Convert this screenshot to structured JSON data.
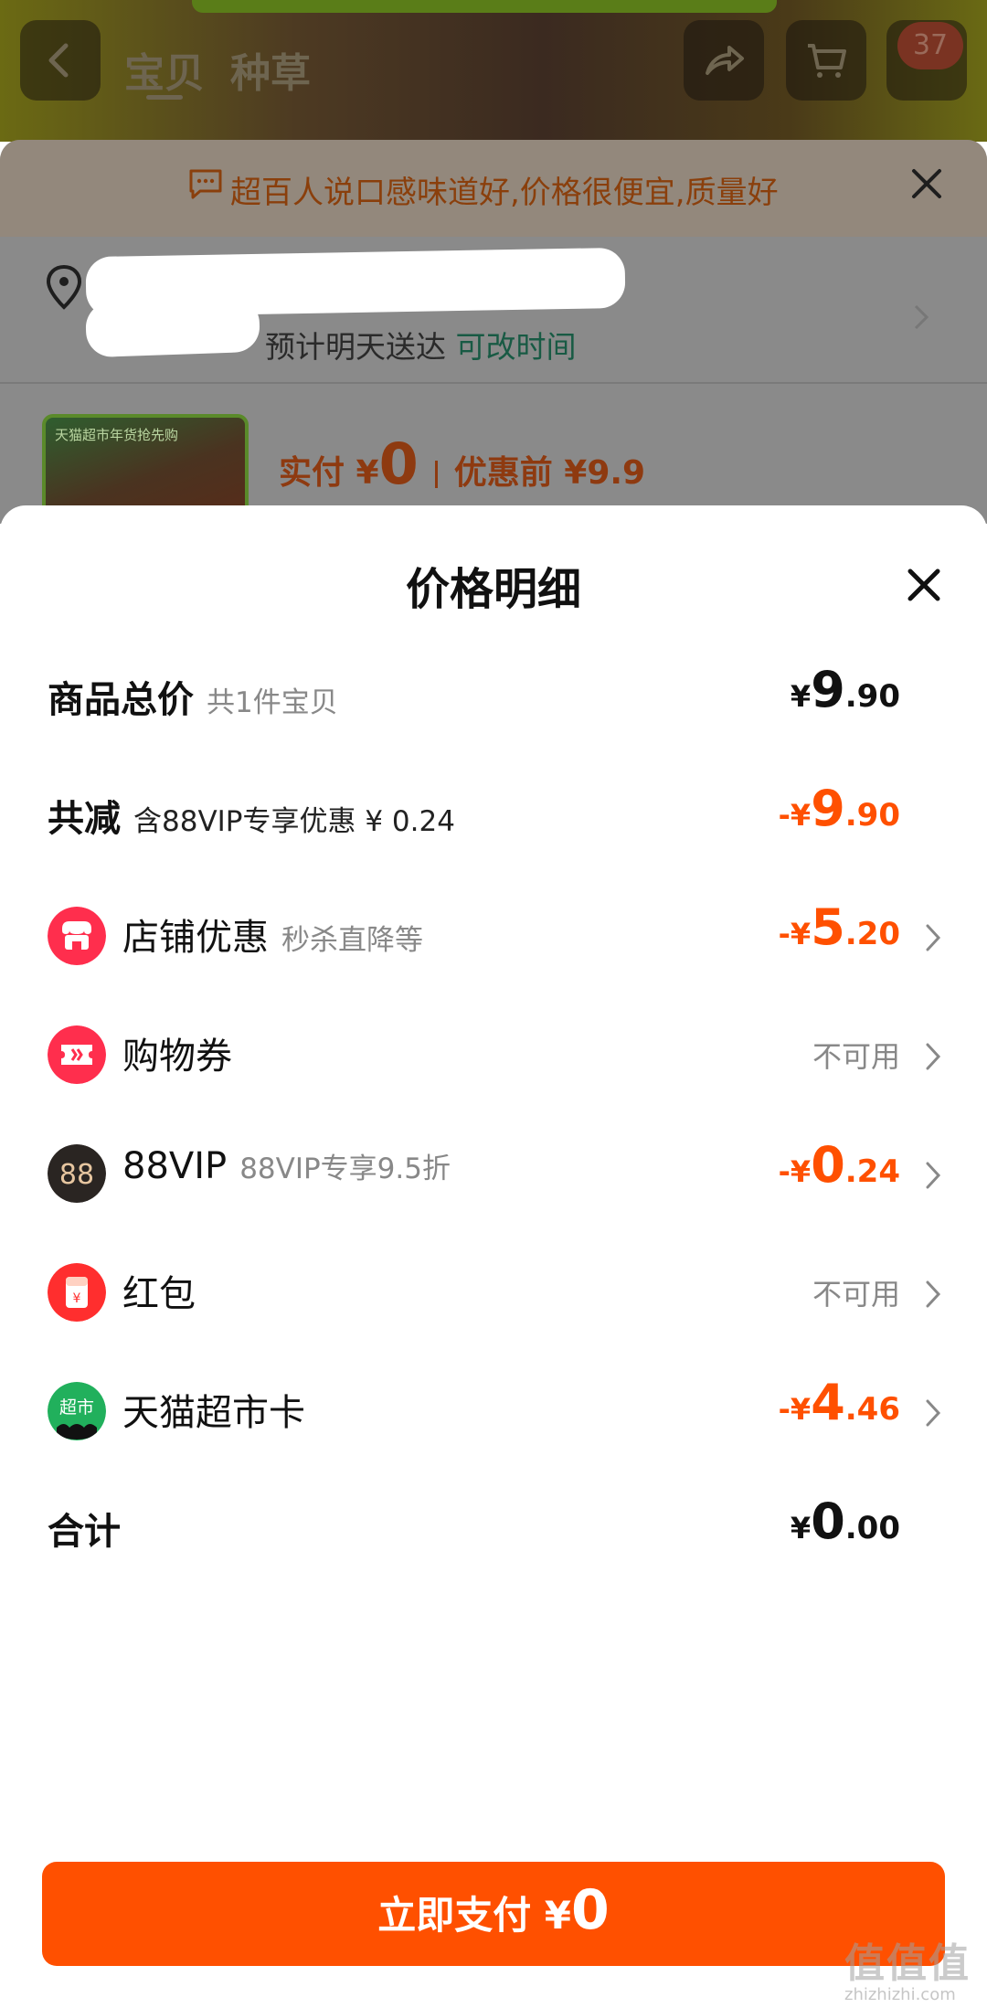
{
  "colors": {
    "accent": "#ff5000",
    "text": "#111111",
    "muted": "#888888"
  },
  "background_page": {
    "tabs": [
      "宝贝",
      "种草"
    ],
    "cart_badge": "37",
    "banner_text": "超百人说口感味道好,价格很便宜,质量好",
    "delivery_text": "预计明天送达",
    "delivery_link": "可改时间",
    "thumb_caption": "天猫超市年货抢先购",
    "pay_label": "实付 ¥",
    "pay_amount": "0",
    "before_discount": "优惠前 ¥9.9"
  },
  "sheet": {
    "title": "价格明细",
    "rows": [
      {
        "label": "商品总价",
        "sub": "共1件宝贝",
        "currency": "¥",
        "int": "9",
        "dec": ".90"
      },
      {
        "label": "共减",
        "sub": "含88VIP专享优惠 ¥ 0.24",
        "currency": "-¥",
        "int": "9",
        "dec": ".90"
      },
      {
        "label": "店铺优惠",
        "sub": "秒杀直降等",
        "icon": "store-icon",
        "currency": "-¥",
        "int": "5",
        "dec": ".20"
      },
      {
        "label": "购物券",
        "sub": "",
        "icon": "coupon-icon",
        "status": "不可用"
      },
      {
        "label": "88VIP",
        "sub": "88VIP专享9.5折",
        "icon": "vip88-icon",
        "icon_text": "88",
        "currency": "-¥",
        "int": "0",
        "dec": ".24"
      },
      {
        "label": "红包",
        "sub": "",
        "icon": "red-packet-icon",
        "icon_text": "¥",
        "status": "不可用"
      },
      {
        "label": "天猫超市卡",
        "sub": "",
        "icon": "tmall-supermarket-card-icon",
        "icon_text": "超市",
        "currency": "-¥",
        "int": "4",
        "dec": ".46"
      },
      {
        "label": "合计",
        "sub": "",
        "currency": "¥",
        "int": "0",
        "dec": ".00"
      }
    ],
    "pay_button": {
      "label": "立即支付 ¥",
      "amount": "0"
    }
  },
  "watermark": {
    "big": "值值值",
    "small": "zhizhizhi.com"
  }
}
